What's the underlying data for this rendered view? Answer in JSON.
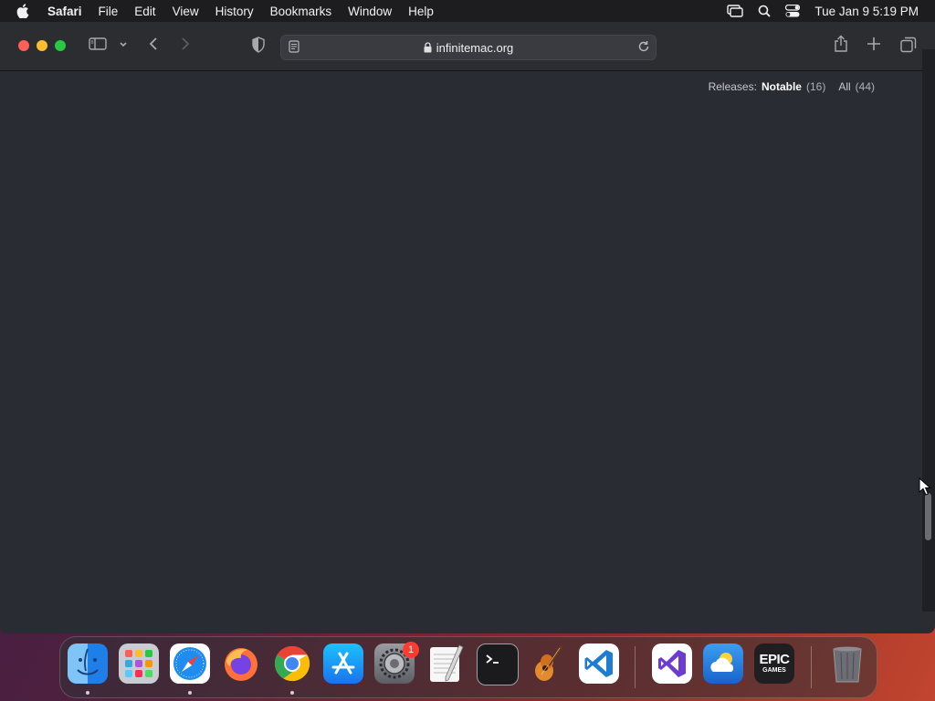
{
  "menubar": {
    "app_name": "Safari",
    "menus": [
      "File",
      "Edit",
      "View",
      "History",
      "Bookmarks",
      "Window",
      "Help"
    ],
    "clock": "Tue Jan 9  5:19 PM"
  },
  "browser": {
    "url": "infinitemac.org"
  },
  "page": {
    "releases_label": "Releases:",
    "notable_label": "Notable",
    "notable_count": "(16)",
    "all_label": "All",
    "all_count": "(44)"
  },
  "dock": {
    "apps": [
      "Finder",
      "Launchpad",
      "Safari",
      "Firefox",
      "Google Chrome",
      "App Store",
      "System Settings",
      "TextEdit",
      "Terminal",
      "GarageBand",
      "Visual Studio Code",
      "Visual Studio",
      "Weather",
      "Epic Games Launcher",
      "Trash"
    ],
    "system_settings_badge": "1",
    "epic_logo_top": "EPIC",
    "epic_logo_bottom": "GAMES"
  }
}
